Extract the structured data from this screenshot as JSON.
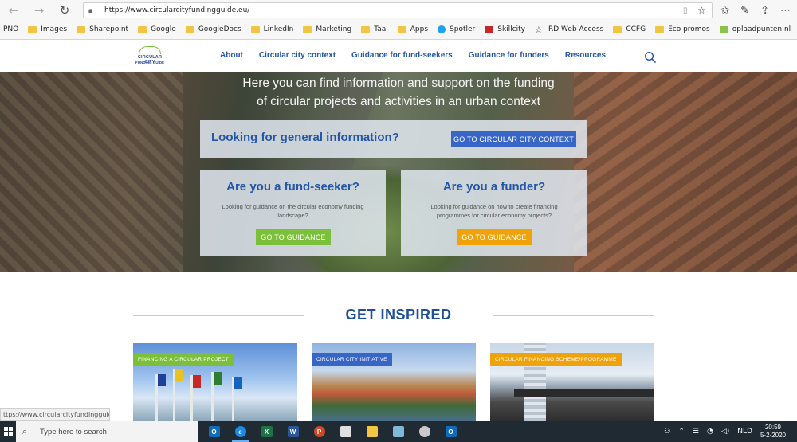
{
  "browser": {
    "url": "https://www.circularcityfundingguide.eu/",
    "bookmarks": [
      {
        "label": "PNO",
        "icon": "none"
      },
      {
        "label": "Images",
        "icon": "folder"
      },
      {
        "label": "Sharepoint",
        "icon": "folder"
      },
      {
        "label": "Google",
        "icon": "folder"
      },
      {
        "label": "GoogleDocs",
        "icon": "folder"
      },
      {
        "label": "LinkedIn",
        "icon": "folder"
      },
      {
        "label": "Marketing",
        "icon": "folder"
      },
      {
        "label": "Taal",
        "icon": "folder"
      },
      {
        "label": "Apps",
        "icon": "folder"
      },
      {
        "label": "Spotler",
        "icon": "spotler"
      },
      {
        "label": "Skillcity",
        "icon": "skillcity"
      },
      {
        "label": "RD Web Access",
        "icon": "star"
      },
      {
        "label": "CCFG",
        "icon": "folder"
      },
      {
        "label": "Eco promos",
        "icon": "folder"
      },
      {
        "label": "oplaadpunten.nl",
        "icon": "green"
      }
    ]
  },
  "site": {
    "logo_line1": "CIRCULAR CITY",
    "logo_line2": "FUNDING GUIDE",
    "nav": [
      "About",
      "Circular city context",
      "Guidance for fund-seekers",
      "Guidance for funders",
      "Resources"
    ]
  },
  "hero": {
    "line1": "Here you can find information and support on the funding",
    "line2": "of circular projects and activities in an urban context",
    "general_question": "Looking for general information?",
    "general_button": "GO TO CIRCULAR CITY CONTEXT",
    "seeker_question": "Are you a fund-seeker?",
    "seeker_desc": "Looking for guidance on the circular economy funding landscape?",
    "seeker_button": "GO TO GUIDANCE",
    "funder_question": "Are you a funder?",
    "funder_desc": "Looking for guidance on how to create financing programmes for circular economy projects?",
    "funder_button": "GO TO GUIDANCE"
  },
  "inspired": {
    "title": "GET INSPIRED",
    "cards": [
      {
        "badge": "FINANCING A CIRCULAR PROJECT"
      },
      {
        "badge": "CIRCULAR CITY INITIATIVE"
      },
      {
        "badge": "CIRCULAR FINANCING SCHEME/PROGRAMME"
      }
    ]
  },
  "statusbar": "ttps://www.circularcityfundingguide.eu/",
  "taskbar": {
    "search_placeholder": "Type here to search",
    "language": "NLD",
    "time": "20:59",
    "date": "5-2-2020"
  },
  "colors": {
    "brand_blue": "#2457a8",
    "button_blue": "#3866c7",
    "green": "#7bbf3a",
    "orange": "#f0a20a"
  }
}
